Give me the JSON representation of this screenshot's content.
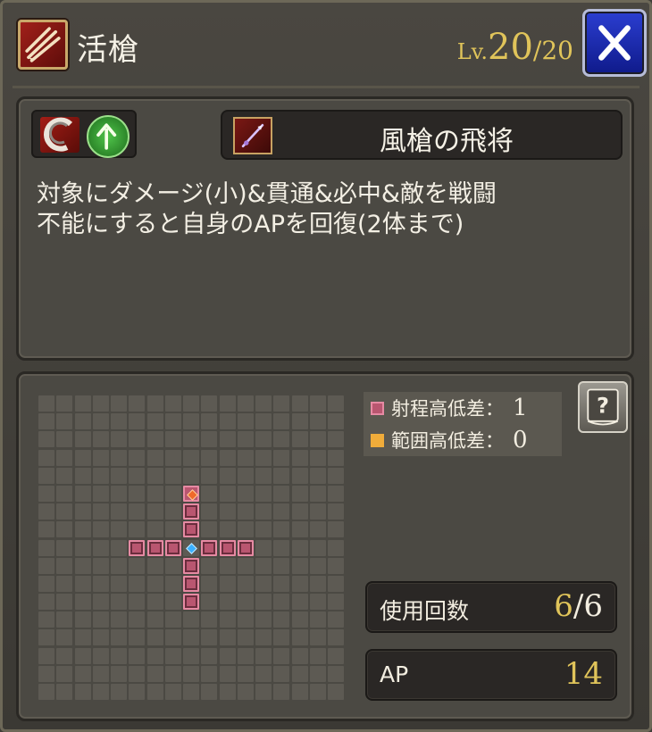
{
  "header": {
    "icon": "slash-attack-icon",
    "skill_name": "活槍",
    "level_prefix": "Lv.",
    "level_current": "20",
    "level_separator": "/",
    "level_max": "20"
  },
  "description_panel": {
    "attribute_icons": [
      "slash-icon",
      "up-arrow-icon"
    ],
    "weapon_icon": "spear-icon",
    "weapon_name": "風槍の飛将",
    "description_line1": "対象にダメージ(小)&貫通&必中&敵を戦闘",
    "description_line2": "不能にすると自身のAPを回復(2体まで)"
  },
  "range_panel": {
    "legend": {
      "range_height_label": "射程高低差：",
      "range_height_value": "1",
      "area_height_label": "範囲高低差：",
      "area_height_value": "0"
    },
    "uses": {
      "label": "使用回数",
      "current": "6",
      "separator": "/",
      "max": "6"
    },
    "ap": {
      "label": "AP",
      "value": "14"
    },
    "grid": {
      "columns": 17,
      "rows": 17,
      "origin": [
        8,
        8
      ],
      "target": [
        8,
        5
      ],
      "range_cells": [
        [
          8,
          6
        ],
        [
          8,
          7
        ],
        [
          5,
          8
        ],
        [
          6,
          8
        ],
        [
          7,
          8
        ],
        [
          9,
          8
        ],
        [
          10,
          8
        ],
        [
          11,
          8
        ],
        [
          8,
          9
        ],
        [
          8,
          10
        ],
        [
          8,
          11
        ]
      ]
    }
  },
  "colors": {
    "range_cell": "#b95670",
    "area_cell": "#f0ac3a",
    "accent_gold": "#e0c45a",
    "close_button": "#1f2fb8"
  }
}
